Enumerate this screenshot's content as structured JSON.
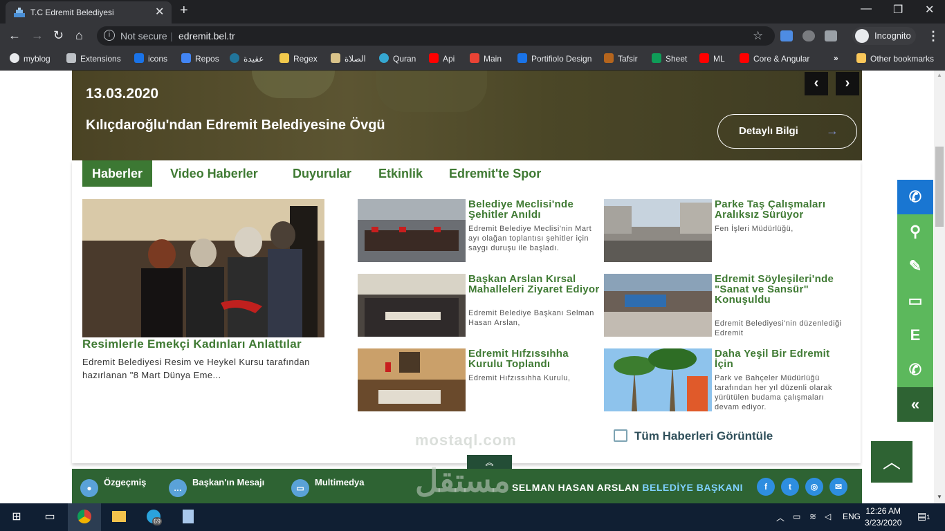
{
  "browser": {
    "tab_title": "T.C Edremit Belediyesi",
    "not_secure": "Not secure",
    "url": "edremit.bel.tr",
    "incognito": "Incognito",
    "bookmarks": [
      "myblog",
      "Extensions",
      "icons",
      "Repos",
      "عقيدة",
      "Regex",
      "الصلاة",
      "Quran",
      "Api",
      "Main",
      "Portifiolo Design",
      "Tafsir",
      "Sheet",
      "ML",
      "Core & Angular"
    ],
    "more_bookmarks": "»",
    "other_bookmarks": "Other bookmarks"
  },
  "hero": {
    "date": "13.03.2020",
    "headline": "Kılıçdaroğlu'ndan Edremit Belediyesine Övgü",
    "detail_button": "Detaylı Bilgi",
    "arrow": "→",
    "prev": "‹",
    "next": "›"
  },
  "tabs": [
    "Haberler",
    "Video Haberler",
    "Duyurular",
    "Etkinlik",
    "Edremit'te Spor"
  ],
  "featured": {
    "title": "Resimlerle Emekçi Kadınları Anlattılar",
    "desc": "Edremit Belediyesi Resim ve Heykel Kursu tarafından hazırlanan \"8 Mart Dünya Eme..."
  },
  "news": [
    {
      "title": "Belediye Meclisi'nde Şehitler Anıldı",
      "desc": "Edremit Belediye Meclisi'nin Mart ayı olağan toplantısı şehitler için saygı duruşu ile başladı."
    },
    {
      "title": "Parke Taş Çalışmaları Aralıksız Sürüyor",
      "desc": "Fen İşleri Müdürlüğü,"
    },
    {
      "title": "Başkan Arslan Kırsal Mahalleleri Ziyaret Ediyor",
      "desc": "Edremit Belediye Başkanı Selman Hasan Arslan,"
    },
    {
      "title": "Edremit Söyleşileri'nde \"Sanat ve Sansür\" Konuşuldu",
      "desc": "Edremit Belediyesi'nin düzenlediği Edremit"
    },
    {
      "title": "Edremit Hıfzıssıhha Kurulu Toplandı",
      "desc": "Edremit  Hıfzıssıhha Kurulu,"
    },
    {
      "title": "Daha Yeşil Bir Edremit İçin",
      "desc": "Park ve Bahçeler Müdürlüğü tarafından her yıl düzenli olarak yürütülen budama çalışmaları devam ediyor."
    }
  ],
  "all_news": "Tüm Haberleri Görüntüle",
  "footer": {
    "items": [
      "Özgeçmiş",
      "Başkan'ın Mesajı",
      "Multimedya"
    ],
    "mayor_name": "SELMAN HASAN ARSLAN",
    "mayor_role": "BELEDİYE BAŞKANI",
    "social": [
      "f",
      "t",
      "◎",
      "✉"
    ]
  },
  "watermark": {
    "arabic": "مستقل",
    "latin": "mostaql.com"
  },
  "side": [
    "✆",
    "⚲",
    "✎",
    "▭",
    "E",
    "✆",
    "«"
  ],
  "taskbar": {
    "lang": "ENG",
    "time": "12:26 AM",
    "date": "3/23/2020",
    "badge": "69",
    "notif": "1"
  },
  "colors": {
    "green": "#3c7833",
    "dark_green": "#2e6333",
    "blue": "#1976d2"
  }
}
